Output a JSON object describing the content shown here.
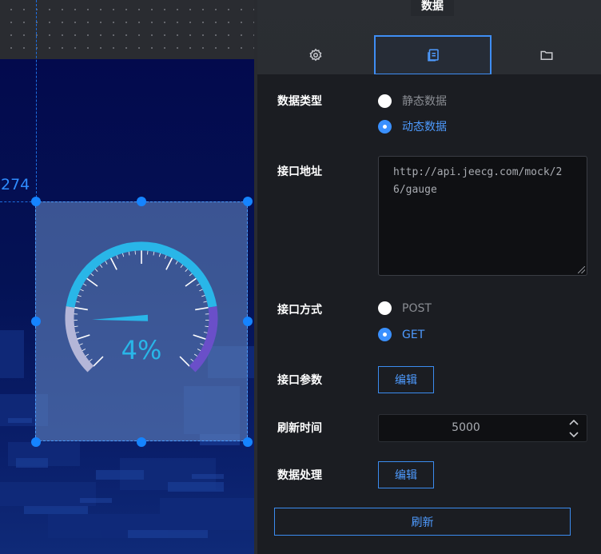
{
  "canvas": {
    "coordinate_label": "274",
    "gauge": {
      "value_text": "4%",
      "percent": 4
    }
  },
  "panel": {
    "tooltip": "数据",
    "tabs": [
      {
        "icon": "gear-icon"
      },
      {
        "icon": "data-pages-icon",
        "active": true
      },
      {
        "icon": "folder-icon"
      }
    ],
    "data_type": {
      "label": "数据类型",
      "options": [
        {
          "label": "静态数据",
          "selected": false
        },
        {
          "label": "动态数据",
          "selected": true
        }
      ]
    },
    "api_url": {
      "label": "接口地址",
      "value": "http://api.jeecg.com/mock/26/gauge"
    },
    "api_method": {
      "label": "接口方式",
      "options": [
        {
          "label": "POST",
          "selected": false
        },
        {
          "label": "GET",
          "selected": true
        }
      ]
    },
    "api_params": {
      "label": "接口参数",
      "button": "编辑"
    },
    "refresh_time": {
      "label": "刷新时间",
      "value": "5000"
    },
    "data_processing": {
      "label": "数据处理",
      "button": "编辑"
    },
    "refresh_button": "刷新",
    "colors": {
      "accent": "#3a90ff",
      "panel_bg": "#1b1d22",
      "gauge_cyan": "#29b6e8",
      "gauge_purple": "#6a4fc9"
    }
  }
}
